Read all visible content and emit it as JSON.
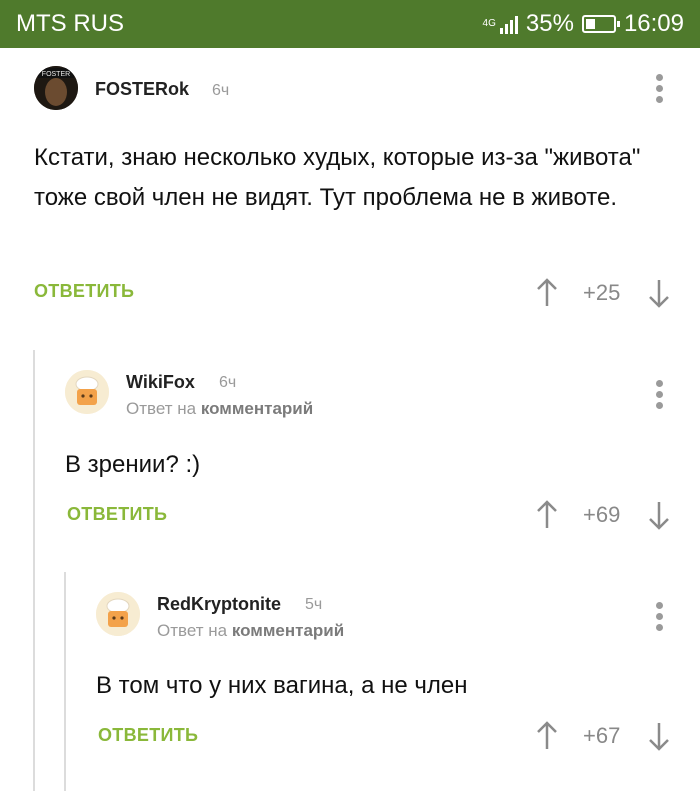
{
  "status_bar": {
    "carrier": "MTS RUS",
    "network": "4G",
    "battery": "35%",
    "battery_level": 0.35,
    "time": "16:09"
  },
  "comments": [
    {
      "author": "FOSTERok",
      "time": "6ч",
      "text": "Кстати, знаю несколько худых, которые из-за \"живота\" тоже свой член не видят. Тут проблема не в животе.",
      "reply_label": "ОТВЕТИТЬ",
      "score": "+25",
      "avatar_label": "FOSTER"
    },
    {
      "author": "WikiFox",
      "time": "6ч",
      "reply_to_prefix": "Ответ на",
      "reply_to_target": "комментарий",
      "text": "В зрении? :)",
      "reply_label": "ОТВЕТИТЬ",
      "score": "+69"
    },
    {
      "author": "RedKryptonite",
      "time": "5ч",
      "reply_to_prefix": "Ответ на",
      "reply_to_target": "комментарий",
      "text": "В том что у них вагина, а не член",
      "reply_label": "ОТВЕТИТЬ",
      "score": "+67"
    }
  ],
  "colors": {
    "status_bar": "#4f7a2c",
    "accent": "#8ab83a",
    "muted": "#9a9a9a"
  }
}
